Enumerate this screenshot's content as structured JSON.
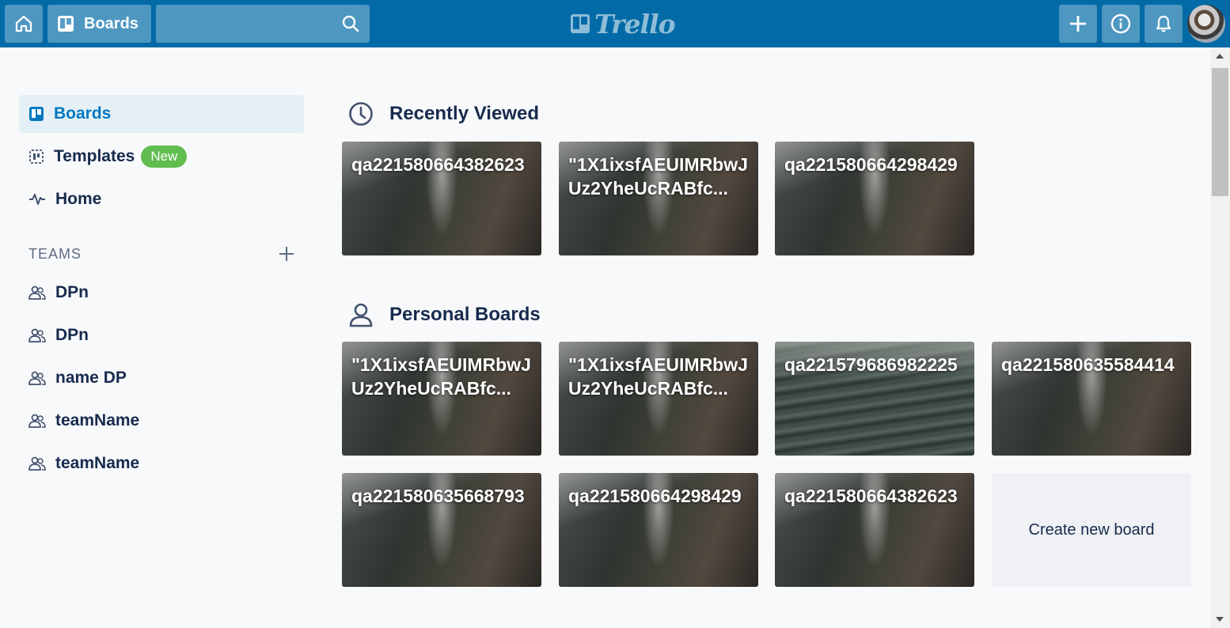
{
  "header": {
    "boards_label": "Boards",
    "search_value": "",
    "logo_text": "Trello"
  },
  "sidebar": {
    "items": [
      {
        "label": "Boards",
        "icon": "board-icon",
        "active": true
      },
      {
        "label": "Templates",
        "icon": "template-icon",
        "badge": "New"
      },
      {
        "label": "Home",
        "icon": "activity-icon"
      }
    ],
    "teams_label": "TEAMS",
    "teams": [
      {
        "label": "DPn"
      },
      {
        "label": "DPn"
      },
      {
        "label": "name DP"
      },
      {
        "label": "teamName"
      },
      {
        "label": "teamName"
      }
    ]
  },
  "recently_viewed": {
    "title": "Recently Viewed",
    "boards": [
      {
        "title": "qa221580664382623"
      },
      {
        "title": "\"1X1ixsfAEUIMRbwJUz2YheUcRABfc..."
      },
      {
        "title": "qa221580664298429"
      }
    ]
  },
  "personal_boards": {
    "title": "Personal Boards",
    "boards": [
      {
        "title": "\"1X1ixsfAEUIMRbwJUz2YheUcRABfc..."
      },
      {
        "title": "\"1X1ixsfAEUIMRbwJUz2YheUcRABfc..."
      },
      {
        "title": "qa221579686982225",
        "background": "water"
      },
      {
        "title": "qa221580635584414"
      },
      {
        "title": "qa221580635668793"
      },
      {
        "title": "qa221580664298429"
      },
      {
        "title": "qa221580664382623"
      }
    ],
    "create_label": "Create new board"
  },
  "colors": {
    "header_bg": "#026aa7",
    "active_nav_bg": "#e4f0f6",
    "active_nav_text": "#0079bf",
    "badge_green": "#61bd4f",
    "text_primary": "#172b4d"
  }
}
